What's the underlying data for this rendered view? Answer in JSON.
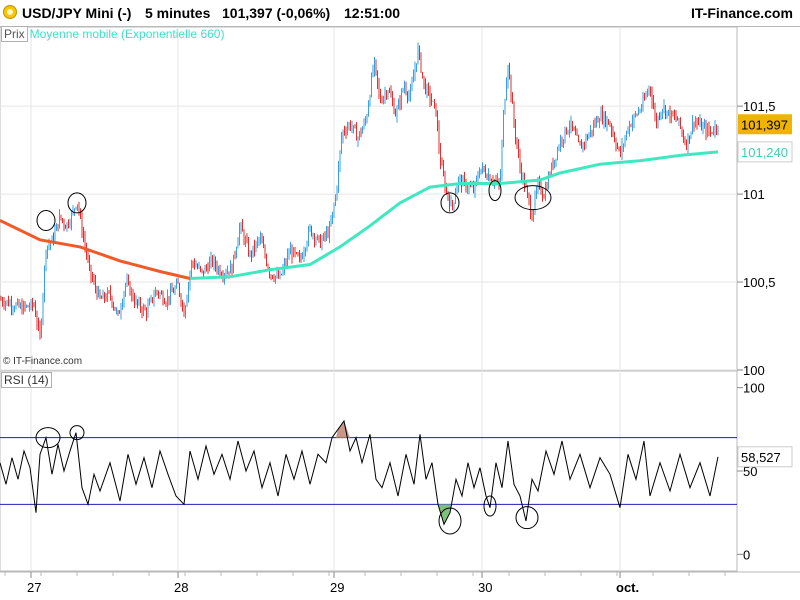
{
  "header": {
    "symbol": "USD/JPY Mini (-)",
    "interval": "5 minutes",
    "price_change": "101,397 (-0,06%)",
    "time": "12:51:00",
    "brand": "IT-Finance.com"
  },
  "legend": {
    "price_tab": "Prix",
    "ma_label": "Moyenne mobile (Exponentielle 660)"
  },
  "copyright": "© IT-Finance.com",
  "rsi_label": "RSI (14)",
  "colors": {
    "ma_fast": "#f05a28",
    "ma_slow": "#40e8c0",
    "up_candle": "#3aa0e0",
    "down_candle": "#e03030",
    "rsi_line": "#000000",
    "rsi_bands": "#2020b0",
    "last_price_bg": "#f0b400",
    "ma_value_color": "#40d0b0",
    "circle_marker": "#000000"
  },
  "chart_data": [
    {
      "type": "line",
      "title": "",
      "xlabel": "",
      "ylabel": "",
      "x_ticks": [
        "27",
        "28",
        "29",
        "30",
        "oct."
      ],
      "y_ticks": [
        "100",
        "100,5",
        "101",
        "101,5"
      ],
      "ylim": [
        100.0,
        101.95
      ],
      "last_price_label": "101,397",
      "ma_value_label": "101,240",
      "grid": true,
      "price_series": {
        "name": "",
        "points": [
          [
            0,
            100.4
          ],
          [
            10,
            100.38
          ],
          [
            22,
            100.35
          ],
          [
            34,
            100.37
          ],
          [
            40,
            100.18
          ],
          [
            46,
            100.7
          ],
          [
            52,
            100.73
          ],
          [
            60,
            100.87
          ],
          [
            66,
            100.82
          ],
          [
            72,
            100.88
          ],
          [
            77,
            100.97
          ],
          [
            82,
            100.8
          ],
          [
            90,
            100.55
          ],
          [
            100,
            100.4
          ],
          [
            110,
            100.43
          ],
          [
            118,
            100.3
          ],
          [
            126,
            100.5
          ],
          [
            136,
            100.38
          ],
          [
            146,
            100.33
          ],
          [
            156,
            100.45
          ],
          [
            166,
            100.4
          ],
          [
            178,
            100.48
          ],
          [
            184,
            100.33
          ],
          [
            192,
            100.62
          ],
          [
            202,
            100.55
          ],
          [
            212,
            100.62
          ],
          [
            222,
            100.55
          ],
          [
            232,
            100.58
          ],
          [
            240,
            100.82
          ],
          [
            250,
            100.65
          ],
          [
            260,
            100.75
          ],
          [
            270,
            100.55
          ],
          [
            280,
            100.52
          ],
          [
            290,
            100.68
          ],
          [
            300,
            100.62
          ],
          [
            310,
            100.8
          ],
          [
            320,
            100.72
          ],
          [
            330,
            100.8
          ],
          [
            336,
            101.0
          ],
          [
            342,
            101.35
          ],
          [
            350,
            101.4
          ],
          [
            358,
            101.32
          ],
          [
            366,
            101.42
          ],
          [
            374,
            101.75
          ],
          [
            380,
            101.53
          ],
          [
            388,
            101.6
          ],
          [
            396,
            101.45
          ],
          [
            404,
            101.62
          ],
          [
            410,
            101.55
          ],
          [
            418,
            101.82
          ],
          [
            424,
            101.62
          ],
          [
            430,
            101.55
          ],
          [
            436,
            101.47
          ],
          [
            440,
            101.2
          ],
          [
            446,
            101.02
          ],
          [
            452,
            100.92
          ],
          [
            458,
            101.08
          ],
          [
            466,
            101.05
          ],
          [
            474,
            101.02
          ],
          [
            480,
            101.15
          ],
          [
            486,
            101.12
          ],
          [
            494,
            101.08
          ],
          [
            500,
            101.05
          ],
          [
            504,
            101.5
          ],
          [
            508,
            101.75
          ],
          [
            514,
            101.4
          ],
          [
            520,
            101.15
          ],
          [
            526,
            101.02
          ],
          [
            532,
            100.88
          ],
          [
            538,
            101.05
          ],
          [
            544,
            101.0
          ],
          [
            550,
            101.12
          ],
          [
            560,
            101.3
          ],
          [
            570,
            101.4
          ],
          [
            580,
            101.26
          ],
          [
            590,
            101.35
          ],
          [
            600,
            101.45
          ],
          [
            610,
            101.4
          ],
          [
            620,
            101.22
          ],
          [
            628,
            101.38
          ],
          [
            636,
            101.45
          ],
          [
            642,
            101.5
          ],
          [
            650,
            101.62
          ],
          [
            656,
            101.4
          ],
          [
            662,
            101.5
          ],
          [
            670,
            101.45
          ],
          [
            678,
            101.42
          ],
          [
            686,
            101.28
          ],
          [
            694,
            101.42
          ],
          [
            702,
            101.38
          ],
          [
            710,
            101.35
          ],
          [
            718,
            101.397
          ]
        ]
      },
      "ma_series": {
        "name": "",
        "points": [
          [
            0,
            100.85
          ],
          [
            40,
            100.74
          ],
          [
            80,
            100.7
          ],
          [
            120,
            100.62
          ],
          [
            160,
            100.56
          ],
          [
            190,
            100.52
          ],
          [
            230,
            100.53
          ],
          [
            270,
            100.57
          ],
          [
            310,
            100.6
          ],
          [
            340,
            100.7
          ],
          [
            370,
            100.82
          ],
          [
            400,
            100.95
          ],
          [
            430,
            101.04
          ],
          [
            460,
            101.06
          ],
          [
            500,
            101.06
          ],
          [
            520,
            101.07
          ],
          [
            540,
            101.08
          ],
          [
            560,
            101.12
          ],
          [
            600,
            101.17
          ],
          [
            640,
            101.19
          ],
          [
            680,
            101.22
          ],
          [
            718,
            101.24
          ]
        ]
      },
      "markers": [
        {
          "x": 46,
          "y": 100.85
        },
        {
          "x": 77,
          "y": 100.95
        },
        {
          "x": 450,
          "y": 100.95
        },
        {
          "x": 495,
          "y": 101.02
        },
        {
          "x": 533,
          "y": 100.98
        }
      ]
    },
    {
      "type": "line",
      "title": "RSI (14)",
      "ylim": [
        0,
        100
      ],
      "y_ticks": [
        "0",
        "50",
        "100"
      ],
      "bands": [
        70,
        30
      ],
      "last_value_label": "58,527",
      "series": [
        {
          "name": "",
          "points": [
            [
              0,
              55
            ],
            [
              6,
              42
            ],
            [
              12,
              58
            ],
            [
              18,
              45
            ],
            [
              24,
              62
            ],
            [
              30,
              52
            ],
            [
              36,
              25
            ],
            [
              40,
              60
            ],
            [
              46,
              70
            ],
            [
              52,
              48
            ],
            [
              58,
              66
            ],
            [
              64,
              50
            ],
            [
              70,
              62
            ],
            [
              76,
              73
            ],
            [
              82,
              40
            ],
            [
              88,
              30
            ],
            [
              94,
              48
            ],
            [
              100,
              38
            ],
            [
              110,
              55
            ],
            [
              120,
              32
            ],
            [
              128,
              60
            ],
            [
              136,
              42
            ],
            [
              144,
              58
            ],
            [
              152,
              40
            ],
            [
              160,
              62
            ],
            [
              168,
              48
            ],
            [
              176,
              35
            ],
            [
              184,
              30
            ],
            [
              190,
              62
            ],
            [
              198,
              45
            ],
            [
              206,
              65
            ],
            [
              214,
              48
            ],
            [
              222,
              60
            ],
            [
              230,
              45
            ],
            [
              238,
              68
            ],
            [
              246,
              50
            ],
            [
              254,
              62
            ],
            [
              262,
              40
            ],
            [
              270,
              55
            ],
            [
              278,
              35
            ],
            [
              286,
              60
            ],
            [
              294,
              45
            ],
            [
              302,
              62
            ],
            [
              310,
              42
            ],
            [
              318,
              60
            ],
            [
              326,
              55
            ],
            [
              332,
              70
            ],
            [
              338,
              75
            ],
            [
              344,
              80
            ],
            [
              350,
              62
            ],
            [
              356,
              70
            ],
            [
              362,
              55
            ],
            [
              370,
              72
            ],
            [
              376,
              45
            ],
            [
              382,
              40
            ],
            [
              390,
              55
            ],
            [
              398,
              35
            ],
            [
              406,
              60
            ],
            [
              414,
              42
            ],
            [
              420,
              72
            ],
            [
              426,
              45
            ],
            [
              432,
              55
            ],
            [
              438,
              30
            ],
            [
              444,
              18
            ],
            [
              450,
              25
            ],
            [
              456,
              45
            ],
            [
              462,
              35
            ],
            [
              468,
              55
            ],
            [
              474,
              40
            ],
            [
              480,
              52
            ],
            [
              486,
              35
            ],
            [
              490,
              28
            ],
            [
              496,
              55
            ],
            [
              502,
              40
            ],
            [
              508,
              68
            ],
            [
              514,
              42
            ],
            [
              520,
              35
            ],
            [
              526,
              20
            ],
            [
              532,
              45
            ],
            [
              538,
              38
            ],
            [
              546,
              62
            ],
            [
              554,
              48
            ],
            [
              562,
              68
            ],
            [
              570,
              45
            ],
            [
              580,
              60
            ],
            [
              590,
              40
            ],
            [
              600,
              58
            ],
            [
              610,
              48
            ],
            [
              620,
              28
            ],
            [
              628,
              60
            ],
            [
              636,
              45
            ],
            [
              644,
              68
            ],
            [
              650,
              35
            ],
            [
              660,
              55
            ],
            [
              670,
              38
            ],
            [
              680,
              60
            ],
            [
              690,
              40
            ],
            [
              700,
              55
            ],
            [
              710,
              35
            ],
            [
              718,
              58.527
            ]
          ]
        }
      ],
      "markers": [
        {
          "x": 48,
          "y": 70
        },
        {
          "x": 77,
          "y": 73
        },
        {
          "x": 450,
          "y": 20
        },
        {
          "x": 490,
          "y": 29
        },
        {
          "x": 527,
          "y": 22
        }
      ]
    }
  ]
}
